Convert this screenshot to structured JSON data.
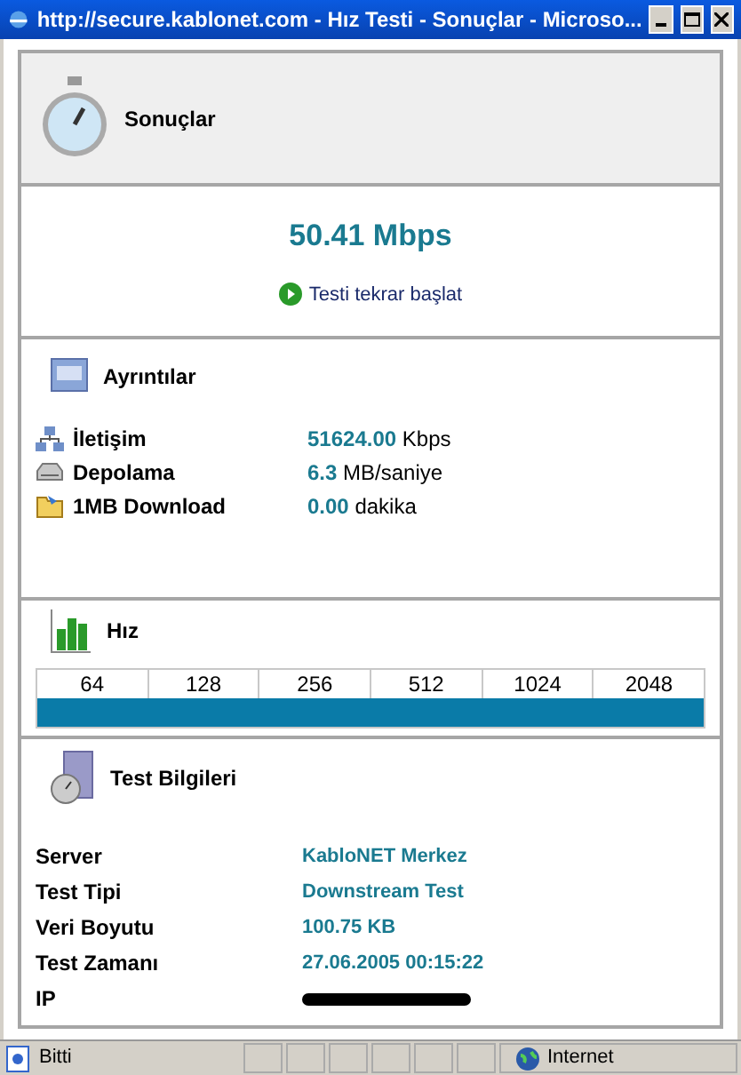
{
  "window": {
    "title": "http://secure.kablonet.com - Hız Testi - Sonuçlar - Microso..."
  },
  "results": {
    "title": "Sonuçlar",
    "speed": "50.41 Mbps",
    "restart_link": "Testi tekrar başlat"
  },
  "details": {
    "title": "Ayrıntılar",
    "rows": [
      {
        "kind": "network",
        "label": "İletişim",
        "value": "51624.00",
        "unit": "Kbps"
      },
      {
        "kind": "disk",
        "label": "Depolama",
        "value": "6.3",
        "unit": "MB/saniye"
      },
      {
        "kind": "folder",
        "label": "1MB Download",
        "value": "0.00",
        "unit": "dakika"
      }
    ]
  },
  "speed_scale": {
    "title": "Hız",
    "labels": [
      "64",
      "128",
      "256",
      "512",
      "1024",
      "2048"
    ],
    "level": 1
  },
  "test_info": {
    "title": "Test Bilgileri",
    "rows": [
      {
        "label": "Server",
        "value": "KabloNET Merkez",
        "redacted": false
      },
      {
        "label": "Test Tipi",
        "value": "Downstream Test",
        "redacted": false
      },
      {
        "label": "Veri Boyutu",
        "value": "100.75 KB",
        "redacted": false
      },
      {
        "label": "Test Zamanı",
        "value": "27.06.2005 00:15:22",
        "redacted": false
      },
      {
        "label": "IP",
        "redacted": true
      }
    ]
  },
  "status_bar": {
    "status": "Bitti",
    "zone": "Internet"
  }
}
